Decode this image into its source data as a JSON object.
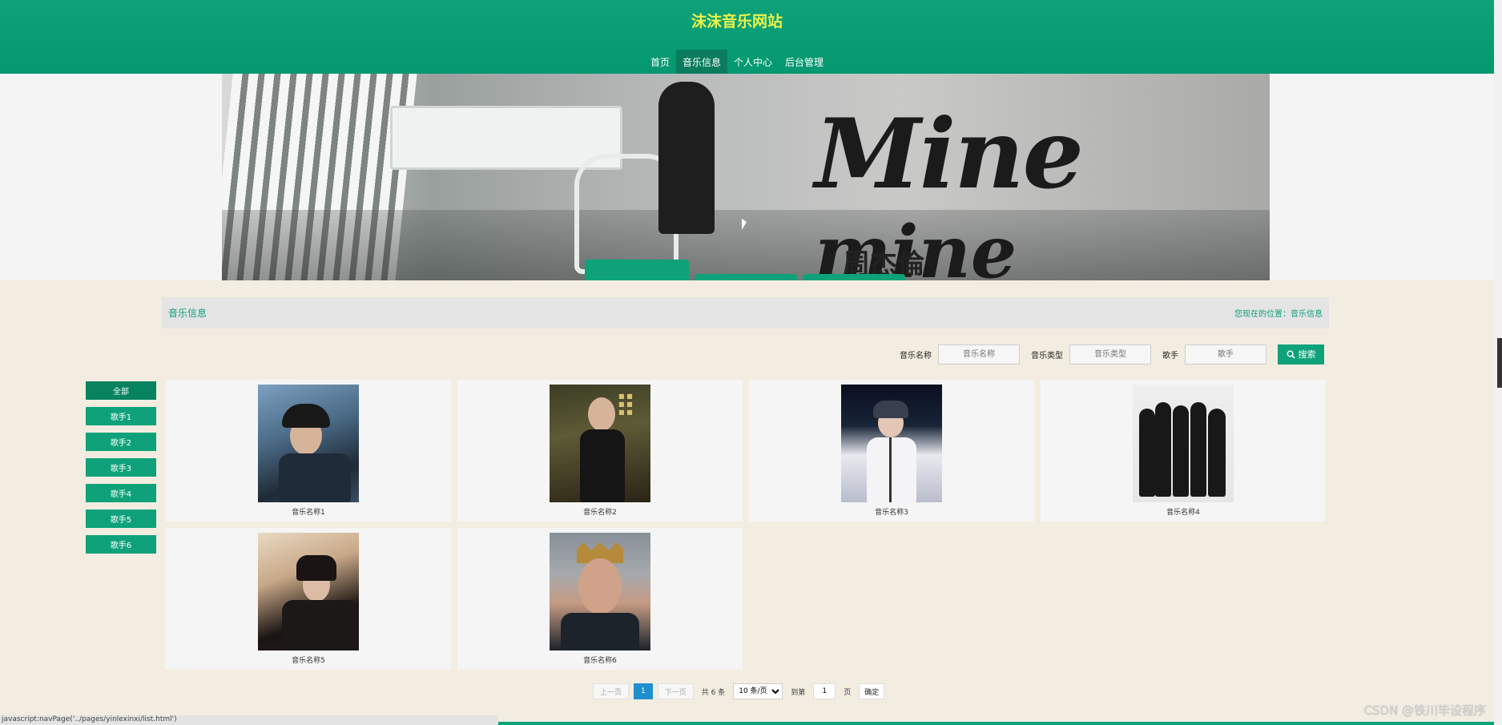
{
  "site": {
    "title": "沫沫音乐网站"
  },
  "nav": [
    {
      "label": "首页",
      "active": false
    },
    {
      "label": "音乐信息",
      "active": true
    },
    {
      "label": "个人中心",
      "active": false
    },
    {
      "label": "后台管理",
      "active": false
    }
  ],
  "banner": {
    "big_text": "Mine",
    "small_text": "mine",
    "singer": "周杰倫"
  },
  "section": {
    "title": "音乐信息",
    "breadcrumb": "您现在的位置：音乐信息"
  },
  "search": {
    "name_label": "音乐名称",
    "name_placeholder": "音乐名称",
    "type_label": "音乐类型",
    "type_placeholder": "音乐类型",
    "singer_label": "歌手",
    "singer_placeholder": "歌手",
    "button_label": "搜索"
  },
  "sidebar": {
    "items": [
      {
        "label": "全部",
        "active": true
      },
      {
        "label": "歌手1"
      },
      {
        "label": "歌手2"
      },
      {
        "label": "歌手3"
      },
      {
        "label": "歌手4"
      },
      {
        "label": "歌手5"
      },
      {
        "label": "歌手6"
      }
    ]
  },
  "music": [
    {
      "name": "音乐名称1"
    },
    {
      "name": "音乐名称2"
    },
    {
      "name": "音乐名称3"
    },
    {
      "name": "音乐名称4"
    },
    {
      "name": "音乐名称5"
    },
    {
      "name": "音乐名称6"
    }
  ],
  "pager": {
    "prev": "上一页",
    "current": "1",
    "next": "下一页",
    "total": "共 6 条",
    "page_size": "10 条/页",
    "goto_prefix": "到第",
    "goto_value": "1",
    "goto_suffix": "页",
    "confirm": "确定"
  },
  "status_bar": "javascript:navPage('../pages/yinlexinxi/list.html')",
  "watermark": "CSDN @铁川毕设程序",
  "colors": {
    "brand": "#0fa27a",
    "title": "#ecf34a",
    "pager_current": "#1e8fcf"
  }
}
